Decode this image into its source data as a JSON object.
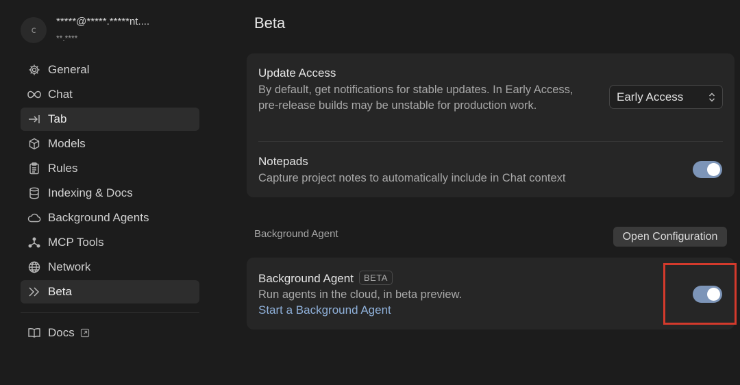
{
  "account": {
    "avatar_initial": "c",
    "name": "*****@*****.*****nt....",
    "email": "**.****"
  },
  "sidebar": {
    "items": [
      {
        "label": "General",
        "icon": "gear-icon"
      },
      {
        "label": "Chat",
        "icon": "infinity-icon"
      },
      {
        "label": "Tab",
        "icon": "tab-arrow-icon",
        "active": true
      },
      {
        "label": "Models",
        "icon": "cube-icon"
      },
      {
        "label": "Rules",
        "icon": "clipboard-icon"
      },
      {
        "label": "Indexing & Docs",
        "icon": "database-icon"
      },
      {
        "label": "Background Agents",
        "icon": "cloud-icon"
      },
      {
        "label": "MCP Tools",
        "icon": "nodes-icon"
      },
      {
        "label": "Network",
        "icon": "globe-icon"
      },
      {
        "label": "Beta",
        "icon": "double-chevron-icon",
        "active": true
      }
    ],
    "docs_label": "Docs"
  },
  "main": {
    "title": "Beta",
    "update_access": {
      "title": "Update Access",
      "description": "By default, get notifications for stable updates. In Early Access, pre-release builds may be unstable for production work.",
      "select_value": "Early Access"
    },
    "notepads": {
      "title": "Notepads",
      "description": "Capture project notes to automatically include in Chat context",
      "enabled": true
    },
    "background_section": {
      "label": "Background Agent",
      "open_config_label": "Open Configuration"
    },
    "background_agent": {
      "title": "Background Agent",
      "badge": "BETA",
      "description": "Run agents in the cloud, in beta preview.",
      "link": "Start a Background Agent",
      "enabled": true
    }
  },
  "colors": {
    "background": "#1c1c1c",
    "card": "#262626",
    "toggle_on": "#7d95b8",
    "link": "#8fb0d9",
    "highlight": "#d33a2c"
  }
}
